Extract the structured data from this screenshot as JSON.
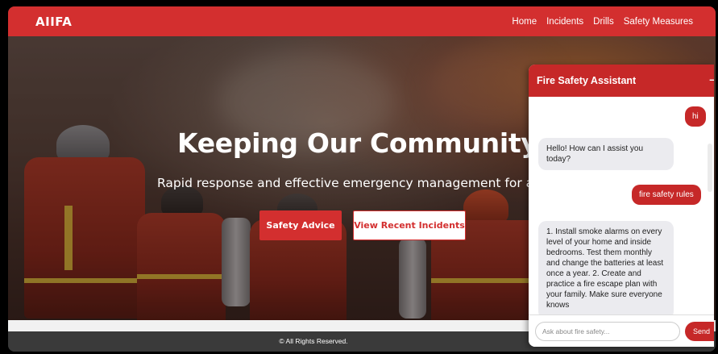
{
  "navbar": {
    "brand": "AIIFA",
    "links": [
      "Home",
      "Incidents",
      "Drills",
      "Safety Measures"
    ]
  },
  "hero": {
    "title": "Keeping Our Community Saf",
    "subtitle": "Rapid response and effective emergency management for all inc",
    "primary_button": "Safety Advice",
    "secondary_button": "View Recent Incidents"
  },
  "footer": {
    "text": "© All Rights Reserved."
  },
  "chat": {
    "title": "Fire Safety Assistant",
    "minimize": "–",
    "messages": [
      {
        "from": "user",
        "text": "hi"
      },
      {
        "from": "bot",
        "text": "Hello! How can I assist you today?"
      },
      {
        "from": "user",
        "text": "fire safety rules"
      },
      {
        "from": "bot",
        "text": "1. Install smoke alarms on every level of your home and inside bedrooms. Test them monthly and change the batteries at least once a year. 2. Create and practice a fire escape plan with your family. Make sure everyone knows"
      }
    ],
    "input_placeholder": "Ask about fire safety...",
    "send_label": "Send"
  },
  "colors": {
    "brand_red": "#d32f2f",
    "chat_red": "#c62828",
    "bot_bubble": "#ebebef"
  }
}
